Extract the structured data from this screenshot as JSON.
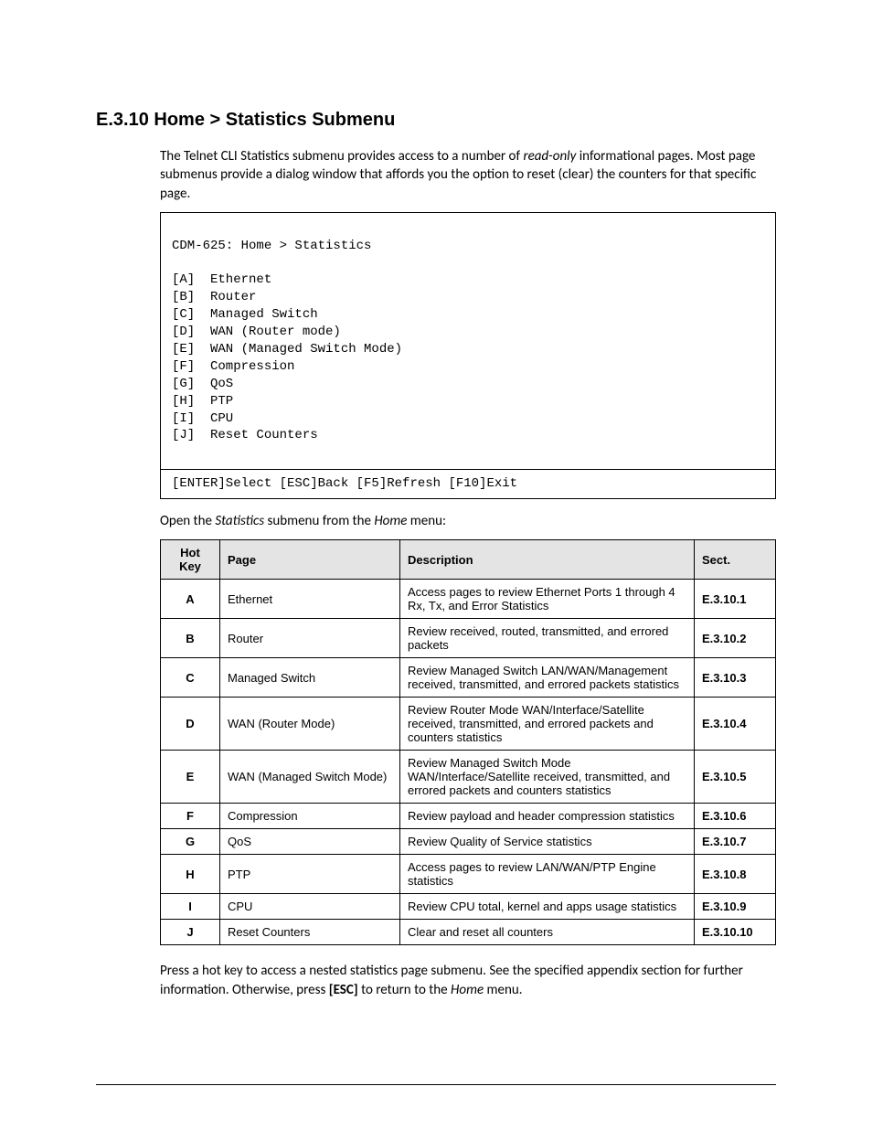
{
  "heading": "E.3.10  Home > Statistics Submenu",
  "intro": {
    "pre": "The Telnet CLI Statistics submenu provides access to a number of ",
    "em": "read-only",
    "post": " informational pages. Most page submenus provide a dialog window that affords you the option to reset (clear) the counters for that specific page."
  },
  "cli": {
    "title": "CDM-625: Home > Statistics",
    "items": [
      "[A]  Ethernet",
      "[B]  Router",
      "[C]  Managed Switch",
      "[D]  WAN (Router mode)",
      "[E]  WAN (Managed Switch Mode)",
      "[F]  Compression",
      "[G]  QoS",
      "[H]  PTP",
      "[I]  CPU",
      "[J]  Reset Counters"
    ],
    "footer": "[ENTER]Select [ESC]Back [F5]Refresh [F10]Exit"
  },
  "open_line": {
    "pre": "Open the ",
    "em1": "Statistics",
    "mid": " submenu from the ",
    "em2": "Home",
    "post": " menu:"
  },
  "table": {
    "headers": {
      "key": "Hot Key",
      "page": "Page",
      "desc": "Description",
      "sect": "Sect."
    },
    "rows": [
      {
        "key": "A",
        "page": "Ethernet",
        "desc": "Access pages to review Ethernet Ports 1 through 4 Rx, Tx, and Error Statistics",
        "sect": "E.3.10.1"
      },
      {
        "key": "B",
        "page": "Router",
        "desc": "Review received, routed, transmitted, and errored packets",
        "sect": "E.3.10.2"
      },
      {
        "key": "C",
        "page": "Managed Switch",
        "desc": "Review Managed Switch LAN/WAN/Management received, transmitted, and errored packets statistics",
        "sect": "E.3.10.3"
      },
      {
        "key": "D",
        "page": "WAN (Router Mode)",
        "desc": "Review Router Mode WAN/Interface/Satellite received, transmitted, and errored packets and counters statistics",
        "sect": "E.3.10.4"
      },
      {
        "key": "E",
        "page": "WAN (Managed Switch Mode)",
        "desc": "Review Managed Switch Mode WAN/Interface/Satellite received, transmitted, and errored packets and counters statistics",
        "sect": "E.3.10.5"
      },
      {
        "key": "F",
        "page": "Compression",
        "desc": "Review payload and header compression statistics",
        "sect": "E.3.10.6"
      },
      {
        "key": "G",
        "page": "QoS",
        "desc": "Review Quality of Service statistics",
        "sect": "E.3.10.7"
      },
      {
        "key": "H",
        "page": "PTP",
        "desc": "Access pages to review LAN/WAN/PTP Engine statistics",
        "sect": "E.3.10.8"
      },
      {
        "key": "I",
        "page": "CPU",
        "desc": "Review CPU total, kernel and apps usage statistics",
        "sect": "E.3.10.9"
      },
      {
        "key": "J",
        "page": "Reset Counters",
        "desc": "Clear and reset all counters",
        "sect": "E.3.10.10"
      }
    ]
  },
  "outro": {
    "pre": "Press a hot key to access a nested statistics page submenu. See the specified appendix section for further information. Otherwise, press ",
    "key": "[ESC]",
    "mid": " to return to the ",
    "em": "Home",
    "post": " menu."
  }
}
